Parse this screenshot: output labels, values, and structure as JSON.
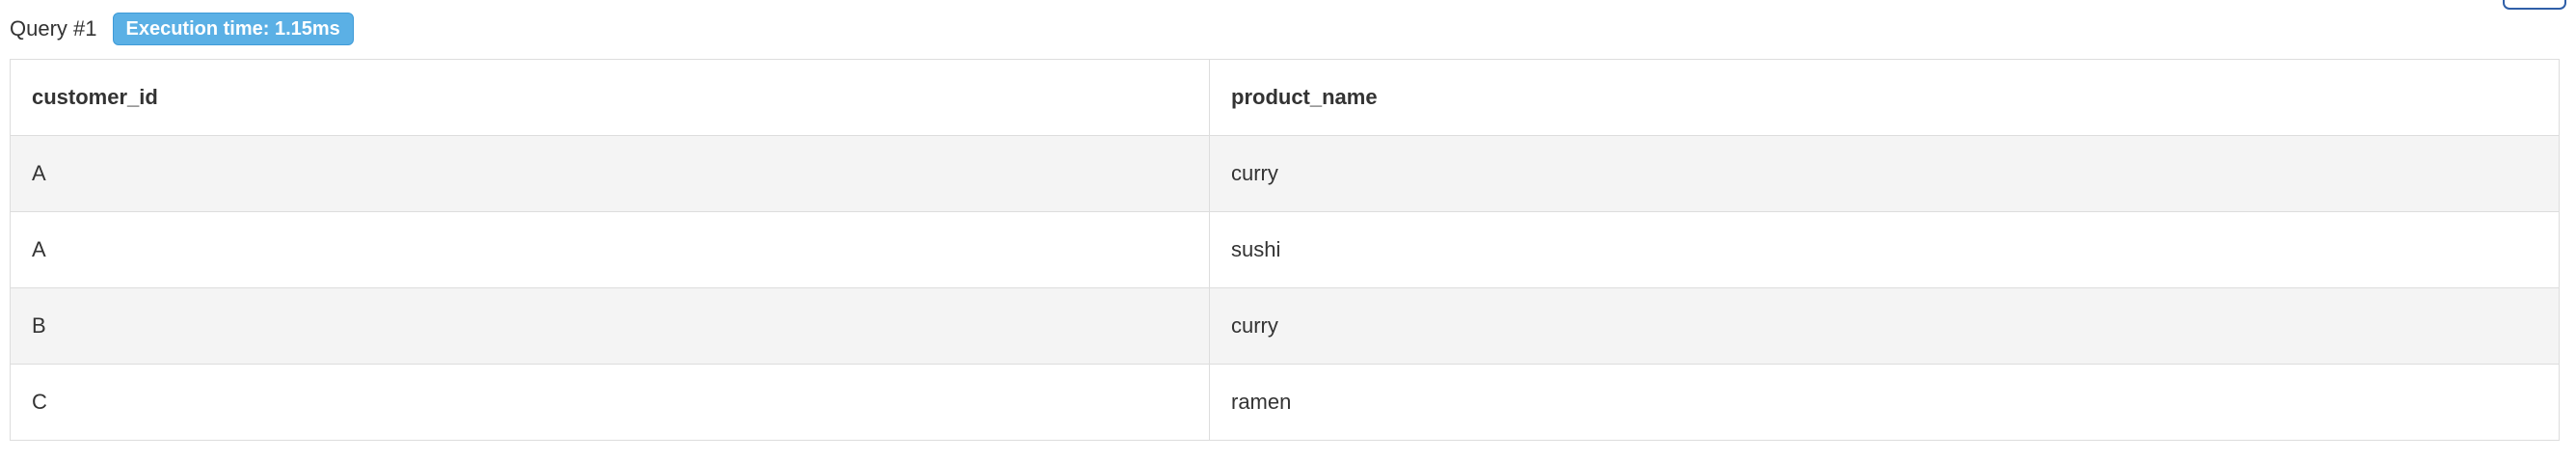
{
  "query": {
    "title": "Query #1",
    "execution_badge": "Execution time: 1.15ms"
  },
  "colors": {
    "badge_background": "#5bb0e5",
    "row_stripe": "#f4f4f4",
    "border": "#dddddd",
    "corner_button_border": "#2f5fa8"
  },
  "table": {
    "columns": [
      "customer_id",
      "product_name"
    ],
    "rows": [
      [
        "A",
        "curry"
      ],
      [
        "A",
        "sushi"
      ],
      [
        "B",
        "curry"
      ],
      [
        "C",
        "ramen"
      ]
    ]
  }
}
